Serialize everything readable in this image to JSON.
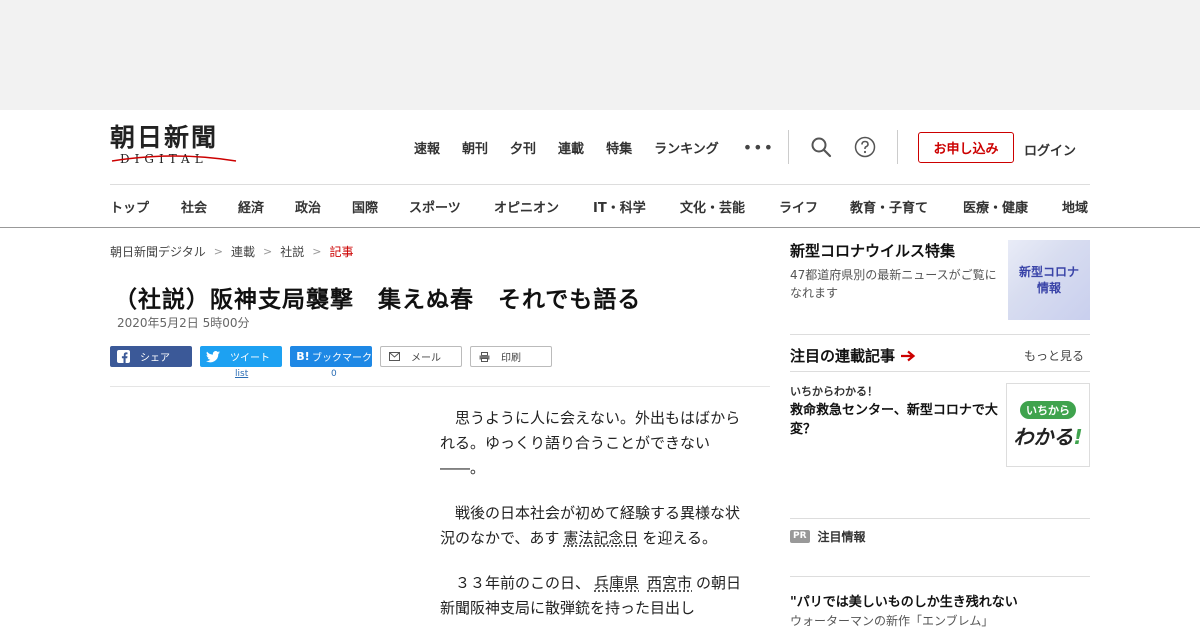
{
  "header": {
    "logo_jp": "朝日新聞",
    "logo_en": "DIGITAL",
    "top_nav": [
      "速報",
      "朝刊",
      "夕刊",
      "連載",
      "特集",
      "ランキング"
    ],
    "more_label": "•••",
    "apply_label": "お申し込み",
    "login_label": "ログイン"
  },
  "category_nav": [
    "トップ",
    "社会",
    "経済",
    "政治",
    "国際",
    "スポーツ",
    "オピニオン",
    "IT・科学",
    "文化・芸能",
    "ライフ",
    "教育・子育て",
    "医療・健康",
    "地域"
  ],
  "breadcrumb": [
    "朝日新聞デジタル",
    "連載",
    "社説",
    "記事"
  ],
  "breadcrumb_sep": ">",
  "article": {
    "title": "（社説）阪神支局襲撃　集えぬ春　それでも語る",
    "date": "2020年5月2日 5時00分",
    "p1": "思うように人に会えない。外出もはばかられる。ゆっくり語り合うことができない――。",
    "p2_a": "戦後の日本社会が初めて経験する異様な状況のなかで、あす",
    "p2_kw": "憲法記念日",
    "p2_b": "を迎える。",
    "p3_a": "３３年前のこの日、",
    "p3_kw1": "兵庫県",
    "p3_kw2": "西宮市",
    "p3_b": "の朝日新聞阪神支局に散弾銃を持った目出し"
  },
  "share": {
    "facebook": "シェア",
    "twitter": "ツイート",
    "hatena": "ブックマーク",
    "hatena_icon": "B!",
    "mail": "メール",
    "print": "印刷",
    "twitter_count": "list",
    "hatena_count": "0"
  },
  "sidebar": {
    "corona_title": "新型コロナウイルス特集",
    "corona_desc": "47都道府県別の最新ニュースがご覧になれます",
    "corona_thumb_l1": "新型コロナ",
    "corona_thumb_l2": "情報",
    "series_head": "注目の連載記事",
    "series_more": "もっと見る",
    "series_kicker": "いちからわかる！",
    "series_title": "救命救急センター、新型コロナで大変？",
    "series_thumb_pill": "いちから",
    "series_thumb_big": "わかる",
    "series_thumb_bang": "!",
    "pr_badge": "PR",
    "pr_head": "注目情報",
    "pr_title": "\"パリでは美しいものしか生き残れない",
    "pr_sub": "ウォーターマンの新作「エンブレム」"
  },
  "colors": {
    "accent": "#cc0000",
    "facebook": "#3b5998",
    "twitter": "#1da1f2",
    "hatena": "#1e88e5"
  }
}
